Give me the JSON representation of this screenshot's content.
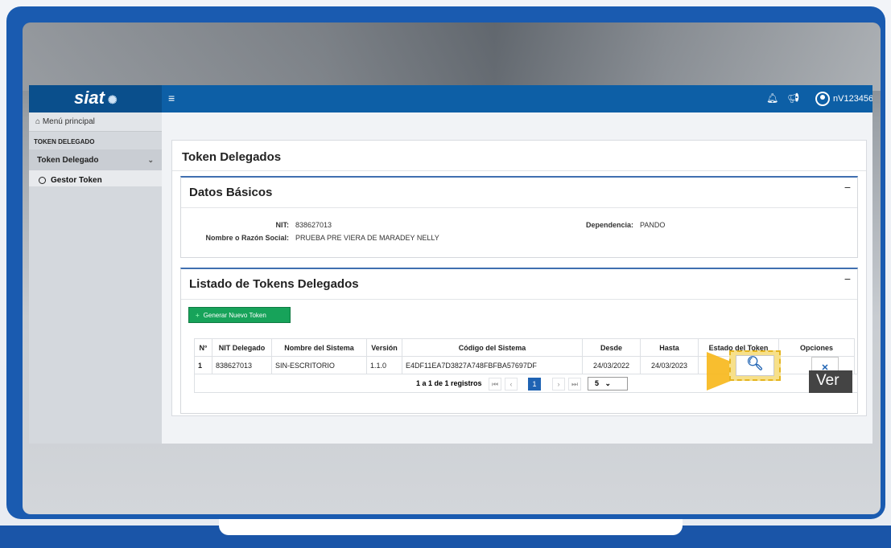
{
  "topbar": {
    "logo_text": "siat",
    "user_label": "nV123456"
  },
  "sidebar": {
    "home_label": "Menú principal",
    "section_label": "TOKEN DELEGADO",
    "group_label": "Token Delegado",
    "item_label": "Gestor Token"
  },
  "page": {
    "title": "Token Delegados"
  },
  "datos": {
    "title": "Datos Básicos",
    "nit_label": "NIT:",
    "nit_value": "838627013",
    "razon_label": "Nombre o Razón Social:",
    "razon_value": "PRUEBA PRE VIERA DE MARADEY NELLY",
    "dependencia_label": "Dependencia:",
    "dependencia_value": "PANDO"
  },
  "listado": {
    "title": "Listado de Tokens Delegados",
    "generate_button": "Generar Nuevo Token",
    "columns": [
      "N°",
      "NIT Delegado",
      "Nombre del Sistema",
      "Versión",
      "Código del Sistema",
      "Desde",
      "Hasta",
      "Estado del Token",
      "Opciones"
    ],
    "rows": [
      {
        "n": "1",
        "nit": "838627013",
        "sistema": "SIN-ESCRITORIO",
        "version": "1.1.0",
        "codigo": "E4DF11EA7D3827A748FBFBA57697DF",
        "desde": "24/03/2022",
        "hasta": "24/03/2023"
      }
    ],
    "pager_text": "1 a 1 de 1 registros",
    "current_page": "1",
    "page_size": "5"
  },
  "callout": {
    "ver_label": "Ver"
  },
  "colors": {
    "primary": "#0d5fa6",
    "frame": "#1a5bb0",
    "success": "#17a35a",
    "highlight": "#f7b718"
  }
}
